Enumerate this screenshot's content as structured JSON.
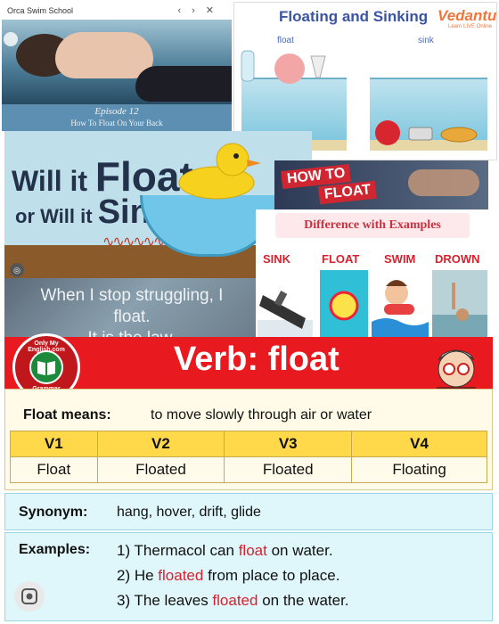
{
  "tile_swim": {
    "window_title": "Orca Swim School",
    "nav_back": "‹",
    "nav_forward": "›",
    "nav_close": "✕",
    "episode": "Episode 12",
    "subtitle": "How To Float On Your Back"
  },
  "tile_vedantu": {
    "title": "Floating and Sinking",
    "brand": "Vedantu",
    "brand_tagline": "Learn LIVE Online",
    "label_float": "float",
    "label_sink": "sink"
  },
  "tile_willit": {
    "line1_small": "Will it",
    "line1_big": "Float",
    "line2_small": "or Will it",
    "line2_big": "Sink",
    "line2_mark": "?"
  },
  "tile_quote": {
    "line1": "When I stop struggling, I float.",
    "line2": "It is the law."
  },
  "tile_howto": {
    "how": "HOW TO",
    "float": "FLOAT"
  },
  "tile_difference": {
    "heading": "Difference with Examples",
    "captions": [
      "SINK",
      "FLOAT",
      "SWIM",
      "DROWN"
    ]
  },
  "banner": {
    "title": "Verb: float",
    "logo_top": "Only My English.com",
    "logo_bottom": "Grammar"
  },
  "definition": {
    "label": "Float means:",
    "value": "to move slowly through air or water",
    "headers": [
      "V1",
      "V2",
      "V3",
      "V4"
    ],
    "forms": [
      "Float",
      "Floated",
      "Floated",
      "Floating"
    ]
  },
  "synonym": {
    "label": "Synonym:",
    "value": "hang, hover, drift, glide"
  },
  "examples": {
    "label": "Examples:",
    "items": [
      {
        "pre": "1) Thermacol can ",
        "word": "float",
        "post": " on water."
      },
      {
        "pre": "2) He ",
        "word": "floated",
        "post": " from place to place."
      },
      {
        "pre": "3) The leaves ",
        "word": "floated",
        "post": " on the water."
      }
    ]
  },
  "colors": {
    "banner_red": "#e8191f",
    "highlight_red": "#d4232f",
    "header_yellow": "#ffd94a",
    "panel_cyan": "#dff6fb",
    "vedantu_blue": "#3a55a2",
    "vedantu_orange": "#f2753b"
  }
}
